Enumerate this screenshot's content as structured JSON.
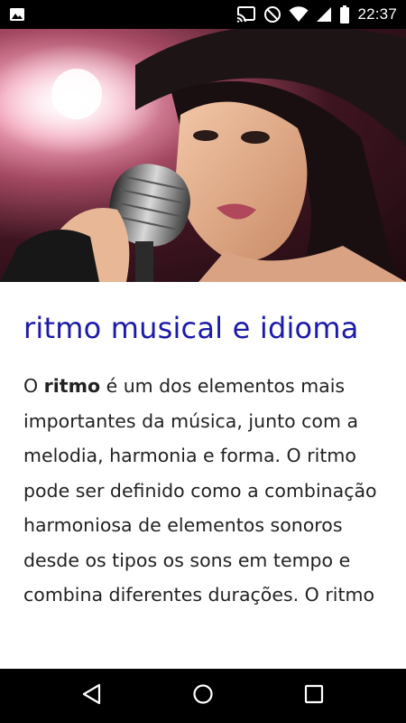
{
  "status_bar": {
    "time": "22:37",
    "icons": [
      "image-icon",
      "cast-icon",
      "do-not-disturb-icon",
      "wifi-icon",
      "signal-icon",
      "battery-icon"
    ]
  },
  "hero": {
    "alt": "singer-with-microphone-photo"
  },
  "article": {
    "title": "ritmo musical e idioma",
    "body_prefix": "O ",
    "body_bold": "ritmo",
    "body_rest": " é um dos elementos mais importantes da música, junto com a melodia, harmonia e forma. O ritmo pode ser definido como a combinação harmoniosa de elementos sonoros desde os tipos os sons em tempo e combina diferentes durações. O ritmo"
  },
  "nav_bar": {
    "buttons": [
      "back-icon",
      "home-icon",
      "recents-icon"
    ]
  },
  "colors": {
    "title": "#1c1aa8",
    "body": "#222222",
    "bars": "#000000"
  }
}
